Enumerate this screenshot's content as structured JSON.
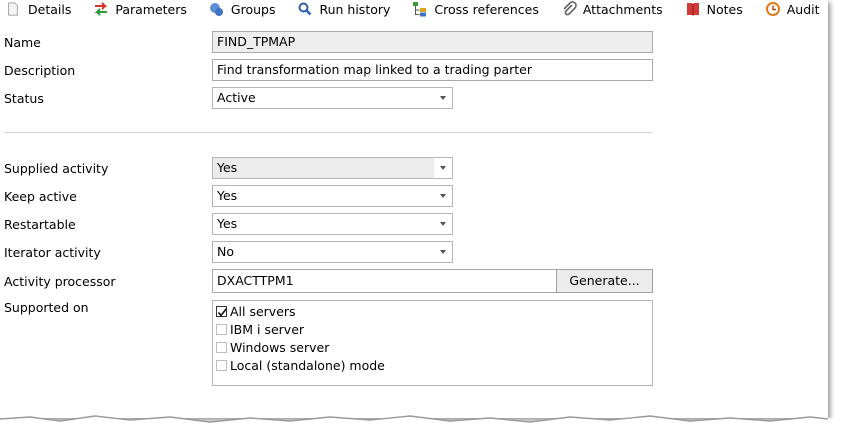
{
  "tabs": [
    {
      "label": "Details",
      "icon": "document-icon"
    },
    {
      "label": "Parameters",
      "icon": "arrows-icon"
    },
    {
      "label": "Groups",
      "icon": "groups-icon"
    },
    {
      "label": "Run history",
      "icon": "magnifier-icon"
    },
    {
      "label": "Cross references",
      "icon": "tree-icon"
    },
    {
      "label": "Attachments",
      "icon": "paperclip-icon"
    },
    {
      "label": "Notes",
      "icon": "notebook-icon"
    },
    {
      "label": "Audit",
      "icon": "clock-icon"
    }
  ],
  "form": {
    "name_label": "Name",
    "name_value": "FIND_TPMAP",
    "description_label": "Description",
    "description_value": "Find transformation map linked to a trading parter",
    "status_label": "Status",
    "status_value": "Active",
    "supplied_label": "Supplied activity",
    "supplied_value": "Yes",
    "keep_active_label": "Keep active",
    "keep_active_value": "Yes",
    "restartable_label": "Restartable",
    "restartable_value": "Yes",
    "iterator_label": "Iterator activity",
    "iterator_value": "No",
    "processor_label": "Activity processor",
    "processor_value": "DXACTTPM1",
    "generate_label": "Generate...",
    "supported_label": "Supported on",
    "supported_options": [
      {
        "label": "All servers",
        "checked": true
      },
      {
        "label": "IBM i server",
        "checked": false
      },
      {
        "label": "Windows server",
        "checked": false
      },
      {
        "label": "Local (standalone) mode",
        "checked": false
      }
    ]
  }
}
